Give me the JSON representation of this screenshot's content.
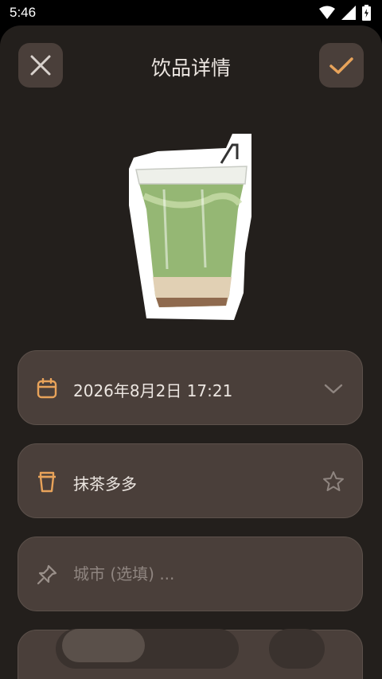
{
  "status_bar": {
    "time": "5:46",
    "icons": [
      "wifi-icon",
      "cellular-signal-icon",
      "battery-charging-icon"
    ]
  },
  "header": {
    "title": "饮品详情",
    "close_icon": "close-icon",
    "confirm_icon": "check-icon"
  },
  "drink": {
    "image": "matcha-latte-cup-photo"
  },
  "fields": {
    "datetime": {
      "value": "2026年8月2日 17:21",
      "icon": "calendar-icon",
      "trail_icon": "chevron-down-icon"
    },
    "drink_name": {
      "value": "抹茶多多",
      "icon": "cup-icon",
      "trail_icon": "star-icon"
    },
    "city": {
      "value": "",
      "placeholder": "城市 (选填) ...",
      "icon": "pin-icon"
    }
  },
  "colors": {
    "background": "#231f1c",
    "surface": "#4a3f3a",
    "accent": "#e8a35a",
    "text": "#ece6e1",
    "placeholder": "#8f8580"
  }
}
